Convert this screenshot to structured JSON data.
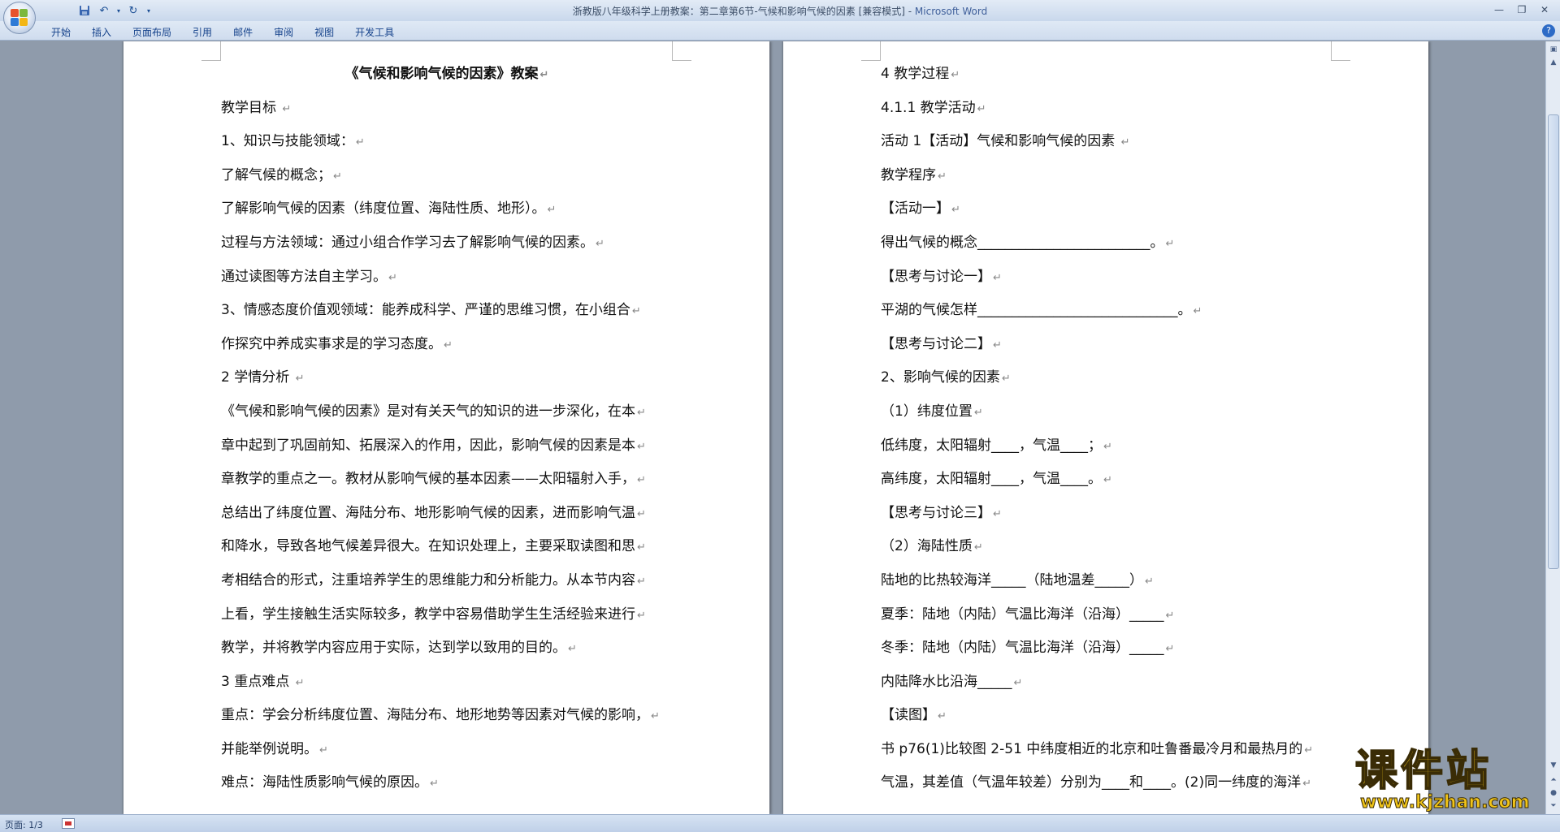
{
  "window": {
    "title": "浙教版八年级科学上册教案：第二章第6节-气候和影响气候的因素 [兼容模式]",
    "app_name": "Microsoft Word",
    "title_separator": " - "
  },
  "quick_access": [
    {
      "name": "save-icon",
      "glyph": "💾"
    },
    {
      "name": "undo-icon",
      "glyph": "↶"
    },
    {
      "name": "undo-dropdown-icon",
      "glyph": "▾"
    },
    {
      "name": "redo-icon",
      "glyph": "↻"
    },
    {
      "name": "customize-qat-icon",
      "glyph": "▾"
    }
  ],
  "ribbon_tabs": [
    "开始",
    "插入",
    "页面布局",
    "引用",
    "邮件",
    "审阅",
    "视图",
    "开发工具"
  ],
  "page1": {
    "title": "《气候和影响气候的因素》教案",
    "lines": [
      "教学目标 ",
      "1、知识与技能领域：",
      "了解气候的概念；",
      "了解影响气候的因素（纬度位置、海陆性质、地形）。",
      "过程与方法领域：通过小组合作学习去了解影响气候的因素。",
      "通过读图等方法自主学习。",
      "3、情感态度价值观领域：能养成科学、严谨的思维习惯，在小组合",
      "作探究中养成实事求是的学习态度。",
      "2 学情分析 ",
      "《气候和影响气候的因素》是对有关天气的知识的进一步深化，在本",
      "章中起到了巩固前知、拓展深入的作用，因此，影响气候的因素是本",
      "章教学的重点之一。教材从影响气候的基本因素——太阳辐射入手，",
      "总结出了纬度位置、海陆分布、地形影响气候的因素，进而影响气温",
      "和降水，导致各地气候差异很大。在知识处理上，主要采取读图和思",
      "考相结合的形式，注重培养学生的思维能力和分析能力。从本节内容",
      "上看，学生接触生活实际较多，教学中容易借助学生生活经验来进行",
      "教学，并将教学内容应用于实际，达到学以致用的目的。",
      "3 重点难点 ",
      "重点：学会分析纬度位置、海陆分布、地形地势等因素对气候的影响，",
      "并能举例说明。",
      "难点：海陆性质影响气候的原因。"
    ]
  },
  "page2": {
    "lines": [
      "4 教学过程",
      "4.1.1 教学活动",
      "活动 1【活动】气候和影响气候的因素 ",
      "教学程序",
      "【活动一】",
      "得出气候的概念_________________________。",
      "【思考与讨论一】",
      "平湖的气候怎样_____________________________。",
      "【思考与讨论二】",
      "2、影响气候的因素",
      "（1）纬度位置",
      "低纬度，太阳辐射____，气温____；",
      " 高纬度，太阳辐射____，气温____。",
      "【思考与讨论三】",
      "（2）海陆性质",
      "陆地的比热较海洋_____（陆地温差_____）",
      "夏季：陆地（内陆）气温比海洋（沿海）_____",
      "冬季：陆地（内陆）气温比海洋（沿海）_____",
      "内陆降水比沿海_____",
      "【读图】",
      "书  p76(1)比较图  2-51  中纬度相近的北京和吐鲁番最冷月和最热月的",
      "气温，其差值（气温年较差）分别为____和____。(2)同一纬度的海洋"
    ]
  },
  "paragraph_mark": "↵",
  "status": {
    "page": "页面: 1/3"
  },
  "watermark": {
    "cn": "课件站",
    "url": "www.kjzhan.com"
  },
  "colors": {
    "app_name": "#3f5f9a",
    "tab_text": "#15428b",
    "watermark": "#f0c419"
  }
}
